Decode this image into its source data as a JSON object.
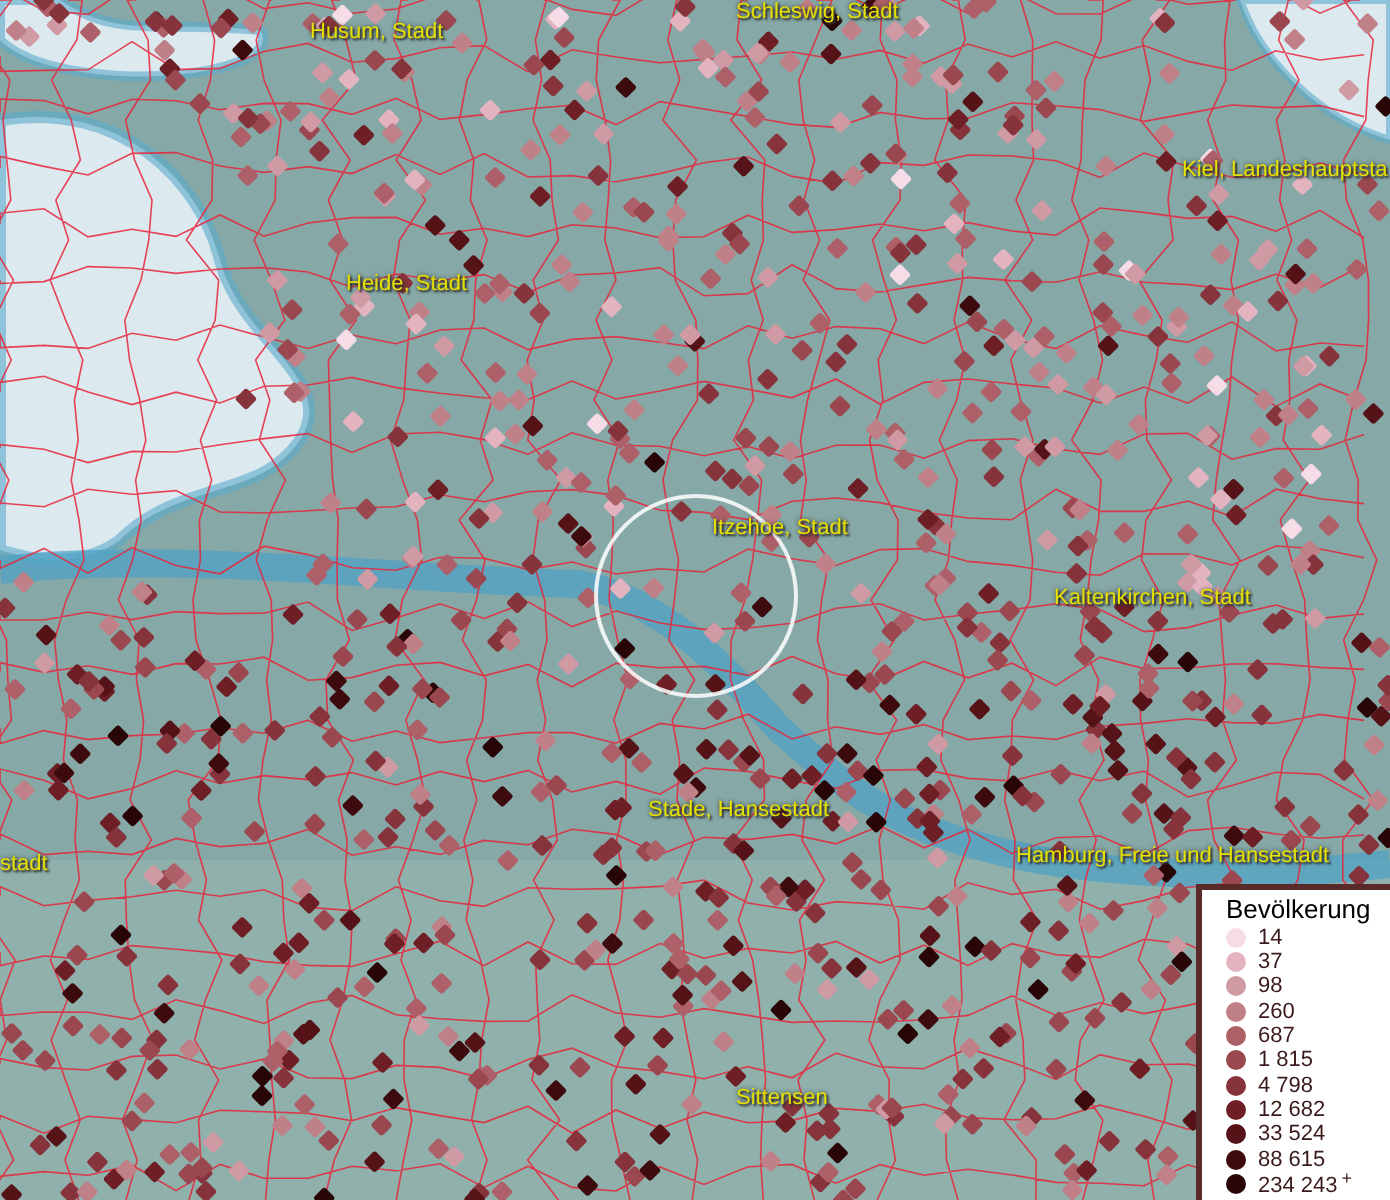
{
  "map": {
    "places": [
      {
        "name": "Schleswig, Stadt"
      },
      {
        "name": "Husum, Stadt"
      },
      {
        "name": "Kiel, Landeshauptsta"
      },
      {
        "name": "Heide, Stadt"
      },
      {
        "name": "Itzehoe, Stadt"
      },
      {
        "name": "Kaltenkirchen, Stadt"
      },
      {
        "name": "Stade, Hansestadt"
      },
      {
        "name": "stadt"
      },
      {
        "name": "Hamburg, Freie und Hansestadt"
      },
      {
        "name": "Sittensen"
      }
    ]
  },
  "legend": {
    "title": "Bevölkerung",
    "items": [
      {
        "label": "14",
        "color": "#f5dce6"
      },
      {
        "label": "37",
        "color": "#e3b4c0"
      },
      {
        "label": "98",
        "color": "#cf9aa3"
      },
      {
        "label": "260",
        "color": "#c08088"
      },
      {
        "label": "687",
        "color": "#ae6068"
      },
      {
        "label": "1 815",
        "color": "#9a474f"
      },
      {
        "label": "4 798",
        "color": "#86333b"
      },
      {
        "label": "12 682",
        "color": "#6e1f25"
      },
      {
        "label": "33 524",
        "color": "#551318"
      },
      {
        "label": "88 615",
        "color": "#3d0a0e"
      },
      {
        "label": "234 243$^{+}$",
        "color": "#280507"
      }
    ]
  }
}
